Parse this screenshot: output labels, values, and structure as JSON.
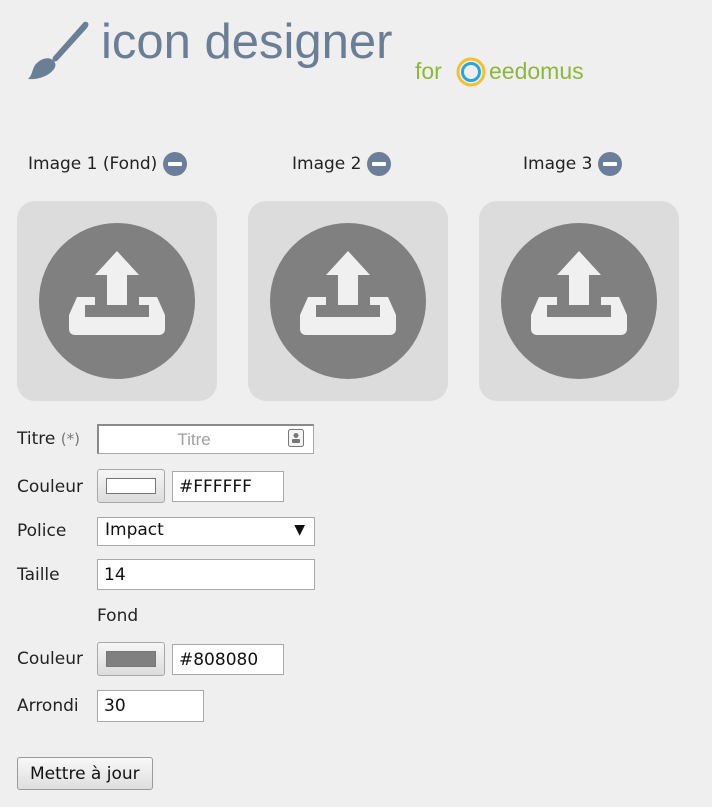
{
  "header": {
    "title": "icon designer",
    "for_text": "for",
    "brand_name": "eedomus",
    "icon_brush": "paintbrush-icon",
    "icon_brand": "eedomus-logo-icon"
  },
  "colors": {
    "title_blue": "#6a7e96",
    "brand_green": "#8cb83a",
    "remove_button": "#6b7f9a",
    "upload_circle": "#808080",
    "slot_background": "#dcdcdc"
  },
  "images": [
    {
      "label": "Image 1 (Fond)",
      "remove_icon": "minus-circle-icon",
      "upload_icon": "upload-icon"
    },
    {
      "label": "Image 2",
      "remove_icon": "minus-circle-icon",
      "upload_icon": "upload-icon"
    },
    {
      "label": "Image 3",
      "remove_icon": "minus-circle-icon",
      "upload_icon": "upload-icon"
    }
  ],
  "form": {
    "title": {
      "label": "Titre",
      "required_mark": "(*)",
      "placeholder": "Titre",
      "value": "",
      "icon": "contact-card-icon"
    },
    "text_color": {
      "label": "Couleur",
      "value": "#FFFFFF"
    },
    "font": {
      "label": "Police",
      "value": "Impact"
    },
    "size": {
      "label": "Taille",
      "value": "14"
    },
    "background_section": "Fond",
    "background_color": {
      "label": "Couleur",
      "value": "#808080"
    },
    "rounding": {
      "label": "Arrondi",
      "value": "30"
    },
    "submit_label": "Mettre à jour"
  }
}
